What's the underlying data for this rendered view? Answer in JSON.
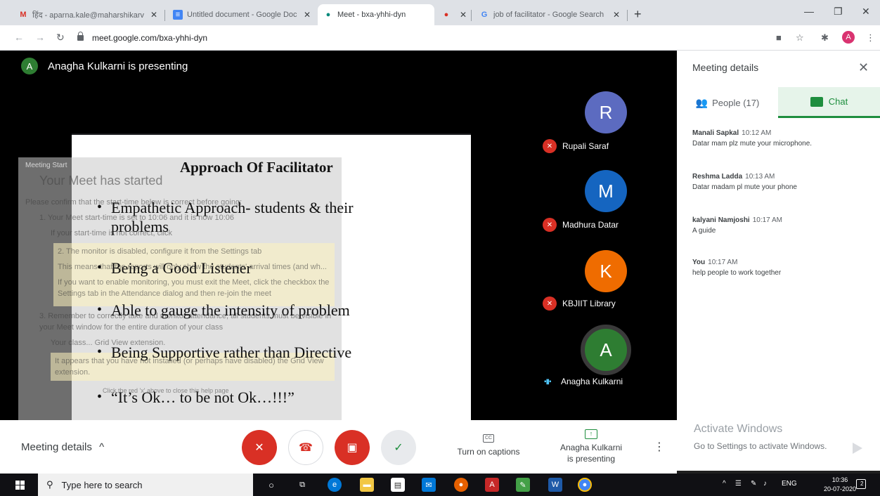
{
  "browser": {
    "tabs": [
      {
        "icon": "M",
        "title": "हिंद - aparna.kale@maharshikarv",
        "active": false
      },
      {
        "icon": "≡",
        "title": "Untitled document - Google Doc",
        "active": false
      },
      {
        "icon": "●",
        "title": "Meet - bxa-yhhi-dyn",
        "active": true
      },
      {
        "icon": "●",
        "title": "",
        "active": false
      },
      {
        "icon": "G",
        "title": "job of facilitator - Google Search",
        "active": false
      }
    ],
    "url": "meet.google.com/bxa-yhhi-dyn",
    "profile_initial": "A"
  },
  "meet": {
    "presenter_initial": "A",
    "presenter_banner": "Anagha Kulkarni is presenting",
    "slide": {
      "title": "Approach Of Facilitator",
      "bullets": [
        "Empathetic Approach- students & their problems",
        "Being a Good Listener",
        "Able to gauge the intensity of problem",
        "Being Supportive rather than Directive",
        "“It’s Ok… to be not Ok…!!!”"
      ]
    },
    "overlay": {
      "header": "Meeting Start",
      "title": "Your Meet has started",
      "lines": [
        "Please confirm that the start-time below is correct before going:",
        "1. Your Meet start-time is set to 10:06 and it is now 10:06",
        "If your start-time is not correct, click",
        "2. The monitor is disabled, configure it from the Settings tab",
        "This means that the reports will only show the students' arrival times (and wh...",
        "If you want to enable monitoring, you must exit the Meet, click the checkbox the Settings tab in the Attendance dialog and then re-join the meet",
        "3. Remember to correctly take and monitor attendance, all students must be visible in your Meet window for the entire duration of your class",
        "Your class... Grid View extension.",
        "It appears that you have not installed (or perhaps have disabled) the Grid View extension.",
        "Click the red 'x' above to close this help page"
      ]
    },
    "participants": [
      {
        "initial": "R",
        "name": "Rupali Saraf",
        "color": "#5c6bc0",
        "muted": true
      },
      {
        "initial": "M",
        "name": "Madhura Datar",
        "color": "#1565c0",
        "muted": true
      },
      {
        "initial": "K",
        "name": "KBJIIT Library",
        "color": "#ef6c00",
        "muted": true
      },
      {
        "initial": "A",
        "name": "Anagha Kulkarni",
        "color": "#2e7d32",
        "muted": false
      }
    ],
    "controls": {
      "meeting_details": "Meeting details",
      "captions": "Turn on captions",
      "present_line1": "Anagha Kulkarni",
      "present_line2": "is presenting"
    }
  },
  "panel": {
    "title": "Meeting details",
    "people_tab": "People (17)",
    "chat_tab": "Chat",
    "messages": [
      {
        "sender": "Manali Sapkal",
        "time": "10:12 AM",
        "text": "Datar mam plz mute your microphone."
      },
      {
        "sender": "Reshma Ladda",
        "time": "10:13 AM",
        "text": "Datar madam pl mute your phone"
      },
      {
        "sender": "kalyani Namjoshi",
        "time": "10:17 AM",
        "text": "A guide"
      },
      {
        "sender": "You",
        "time": "10:17 AM",
        "text": "help people to work together"
      }
    ],
    "activate_title": "Activate Windows",
    "activate_sub": "Go to Settings to activate Windows."
  },
  "taskbar": {
    "search_placeholder": "Type here to search",
    "lang": "ENG",
    "time": "10:36",
    "date": "20-07-2020",
    "notification_count": "2"
  }
}
